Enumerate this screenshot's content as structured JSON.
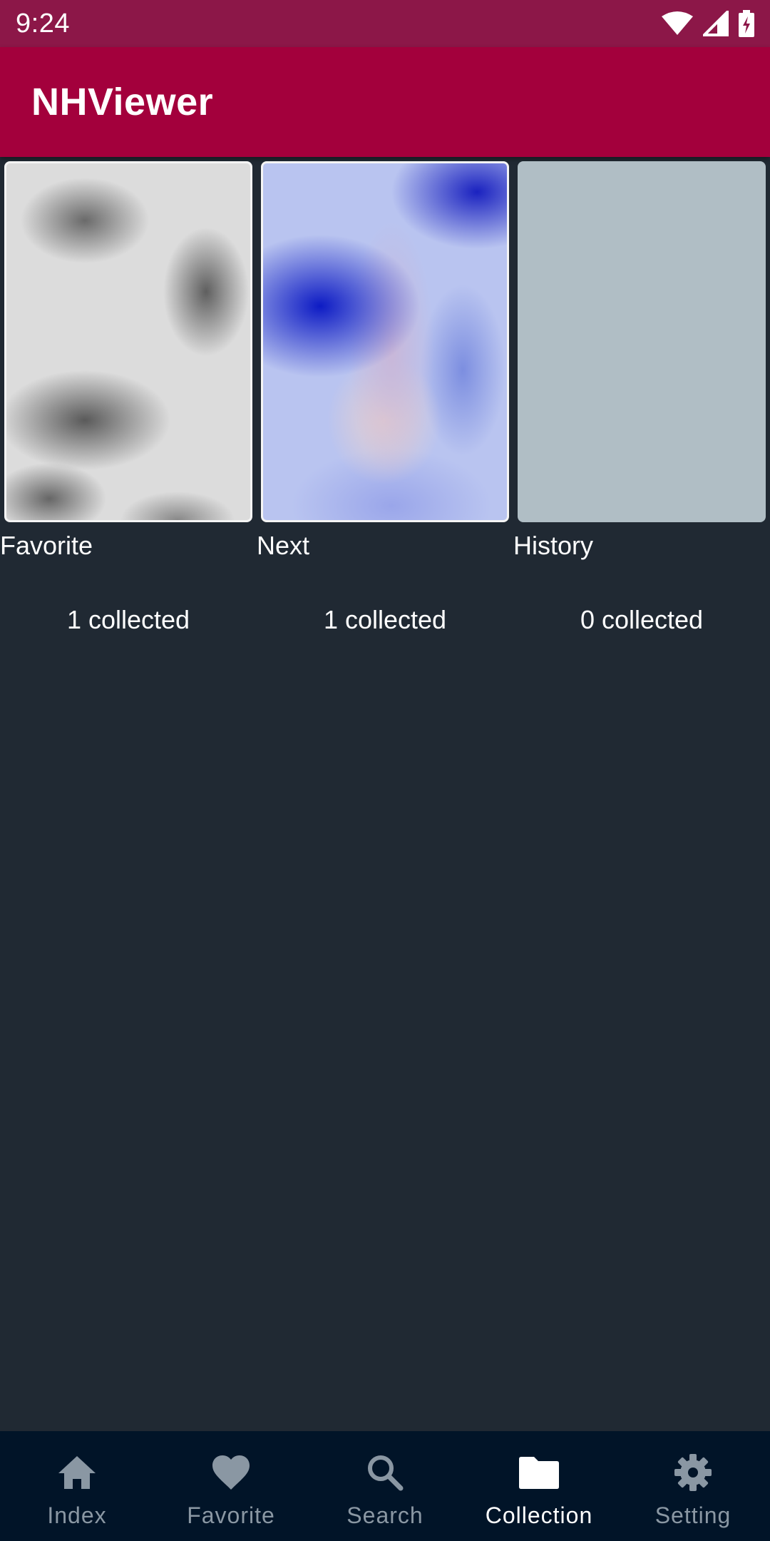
{
  "status_bar": {
    "time": "9:24"
  },
  "app_bar": {
    "title": "NHViewer"
  },
  "collections": [
    {
      "name": "Favorite",
      "count": "1 collected"
    },
    {
      "name": "Next",
      "count": "1 collected"
    },
    {
      "name": "History",
      "count": "0 collected"
    }
  ],
  "bottom_nav": {
    "items": [
      {
        "label": "Index",
        "icon": "home-icon"
      },
      {
        "label": "Favorite",
        "icon": "heart-icon"
      },
      {
        "label": "Search",
        "icon": "search-icon"
      },
      {
        "label": "Collection",
        "icon": "folder-icon"
      },
      {
        "label": "Setting",
        "icon": "gear-icon"
      }
    ],
    "active_label": "Collection"
  },
  "colors": {
    "status_bar": "#8c1748",
    "app_bar": "#a3003c",
    "background": "#202933",
    "bottom_nav": "#011428",
    "nav_inactive": "#8a97a3",
    "nav_active": "#ffffff",
    "placeholder": "#b0bec5"
  }
}
